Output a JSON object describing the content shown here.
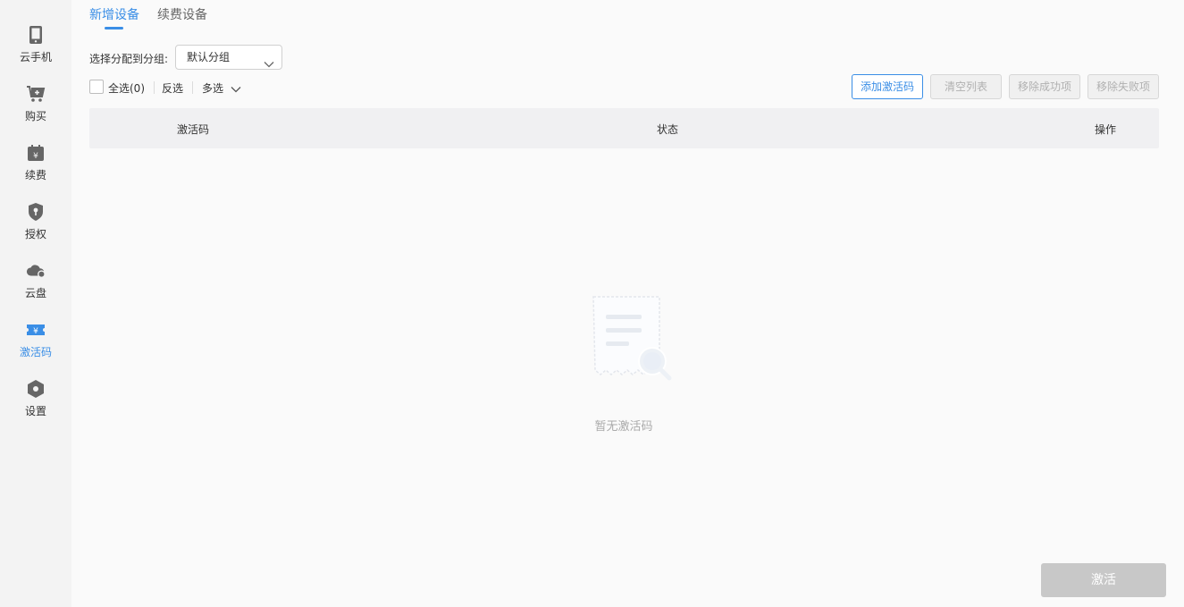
{
  "sidebar": {
    "items": [
      {
        "label": "云手机",
        "icon": "phone-icon"
      },
      {
        "label": "购买",
        "icon": "cart-icon"
      },
      {
        "label": "续费",
        "icon": "renew-calendar-icon"
      },
      {
        "label": "授权",
        "icon": "shield-key-icon"
      },
      {
        "label": "云盘",
        "icon": "cloud-disk-icon"
      },
      {
        "label": "激活码",
        "icon": "ticket-icon",
        "active": true
      },
      {
        "label": "设置",
        "icon": "gear-hex-icon"
      }
    ]
  },
  "tabs": [
    {
      "label": "新增设备",
      "active": true
    },
    {
      "label": "续费设备"
    }
  ],
  "group": {
    "label": "选择分配到分组:",
    "selected": "默认分组"
  },
  "selection": {
    "select_all": "全选(0)",
    "invert": "反选",
    "multi": "多选"
  },
  "toolbar": {
    "add_code": "添加激活码",
    "clear_list": "清空列表",
    "remove_success": "移除成功项",
    "remove_failed": "移除失败项"
  },
  "table": {
    "columns": [
      "激活码",
      "状态",
      "操作"
    ]
  },
  "empty": {
    "text": "暂无激活码"
  },
  "footer": {
    "activate": "激活"
  },
  "colors": {
    "accent": "#3a8ee6",
    "disabled": "#c8c8c8"
  }
}
